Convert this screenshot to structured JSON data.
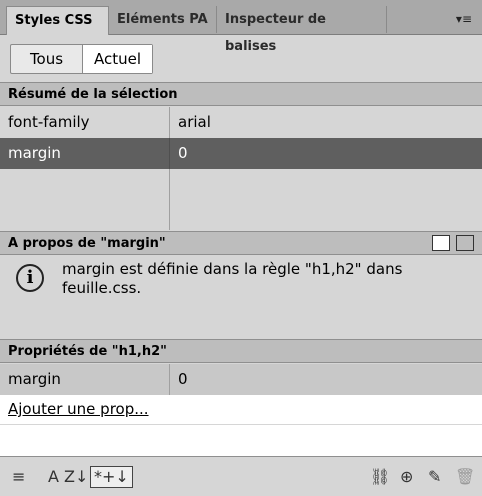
{
  "tabs": {
    "t1": "Styles CSS",
    "t2": "Eléments PA",
    "t3": "Inspecteur de balises",
    "menu": "▾≡"
  },
  "modes": {
    "all": "Tous",
    "current": "Actuel"
  },
  "summary": {
    "title": "Résumé de la sélection",
    "rows": [
      {
        "prop": "font-family",
        "value": "arial"
      },
      {
        "prop": "margin",
        "value": "0"
      }
    ]
  },
  "about": {
    "title": "A propos de \"margin\"",
    "text": "margin est définie dans la règle \"h1,h2\" dans feuille.css."
  },
  "properties": {
    "title": "Propriétés de \"h1,h2\"",
    "rows": [
      {
        "prop": "margin",
        "value": "0"
      }
    ],
    "add_label": "Ajouter une prop..."
  },
  "toolbar": {
    "category_icon": "≡",
    "az_label": "A Z↓",
    "set_label": "*+↓"
  }
}
